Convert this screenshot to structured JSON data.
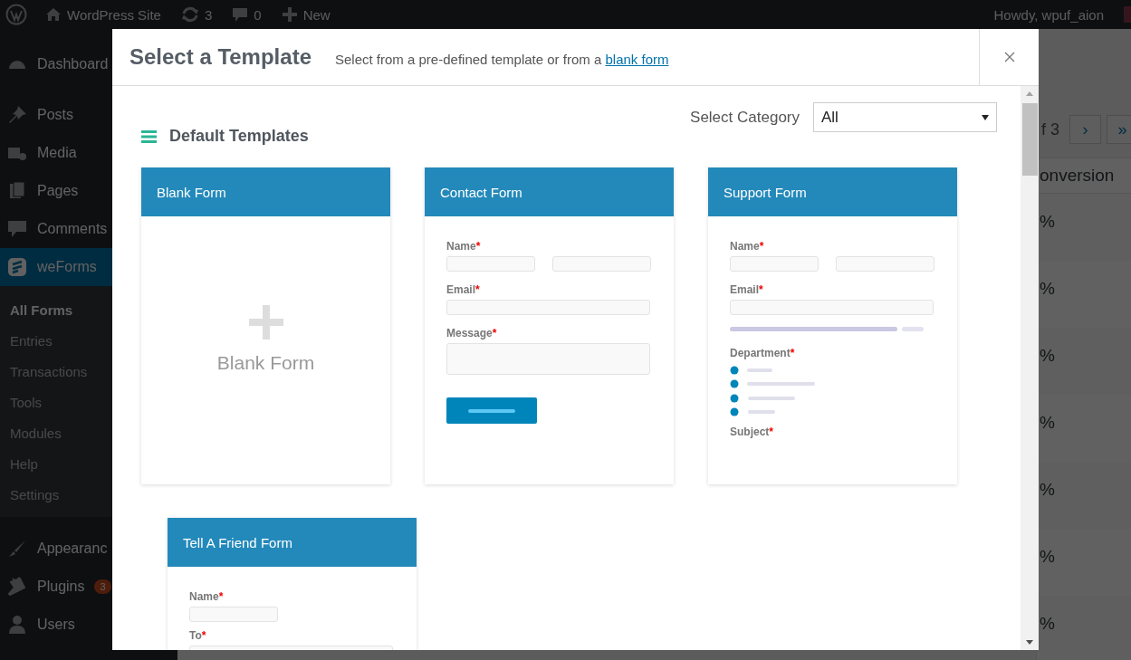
{
  "admin_bar": {
    "site_name": "WordPress Site",
    "updates_count": "3",
    "comments_count": "0",
    "new_label": "New",
    "greeting": "Howdy, wpuf_aion"
  },
  "sidebar": {
    "items": [
      {
        "label": "Dashboard",
        "selected": false
      },
      {
        "label": "Posts",
        "selected": false
      },
      {
        "label": "Media",
        "selected": false
      },
      {
        "label": "Pages",
        "selected": false
      },
      {
        "label": "Comments",
        "selected": false
      },
      {
        "label": "weForms",
        "selected": true,
        "children": [
          {
            "label": "All Forms",
            "selected": true
          },
          {
            "label": "Entries",
            "selected": false
          },
          {
            "label": "Transactions",
            "selected": false
          },
          {
            "label": "Tools",
            "selected": false
          },
          {
            "label": "Modules",
            "selected": false
          },
          {
            "label": "Help",
            "selected": false
          },
          {
            "label": "Settings",
            "selected": false
          }
        ]
      },
      {
        "label": "Appearanc",
        "selected": false
      },
      {
        "label": "Plugins",
        "selected": false,
        "badge": "3"
      },
      {
        "label": "Users",
        "selected": false
      }
    ]
  },
  "background_page": {
    "pagination_text": "f 3",
    "next_button": "›",
    "last_button": "»",
    "column_header": "onversion",
    "cells": [
      "%",
      "%",
      "%",
      "%",
      "%",
      "%",
      "%"
    ]
  },
  "modal": {
    "title": "Select a Template",
    "subtitle": "Select from a pre-defined template or from a ",
    "subtitle_link": "blank form",
    "category_label": "Select Category",
    "category_value": "All",
    "section_title": "Default Templates",
    "cards": [
      {
        "title": "Blank Form",
        "kind": "blank",
        "caption": "Blank Form"
      },
      {
        "title": "Contact Form",
        "kind": "preview",
        "fields": [
          {
            "kind": "name",
            "label": "Name",
            "required_mark": "*"
          },
          {
            "kind": "input",
            "label": "Email",
            "required_mark": "*"
          },
          {
            "kind": "textarea",
            "label": "Message",
            "required_mark": "*"
          },
          {
            "kind": "button"
          }
        ]
      },
      {
        "title": "Support Form",
        "kind": "preview",
        "fields": [
          {
            "kind": "name",
            "label": "Name",
            "required_mark": "*"
          },
          {
            "kind": "input",
            "label": "Email",
            "required_mark": "*"
          },
          {
            "kind": "bar"
          },
          {
            "kind": "radios",
            "label": "Department",
            "required_mark": "*"
          },
          {
            "kind": "label",
            "label": "Subject",
            "required_mark": "*"
          }
        ]
      },
      {
        "title": "Tell A Friend Form",
        "kind": "preview",
        "fields": [
          {
            "kind": "short-input",
            "label": "Name",
            "required_mark": "*"
          },
          {
            "kind": "input",
            "label": "To",
            "required_mark": "*"
          }
        ]
      }
    ]
  }
}
